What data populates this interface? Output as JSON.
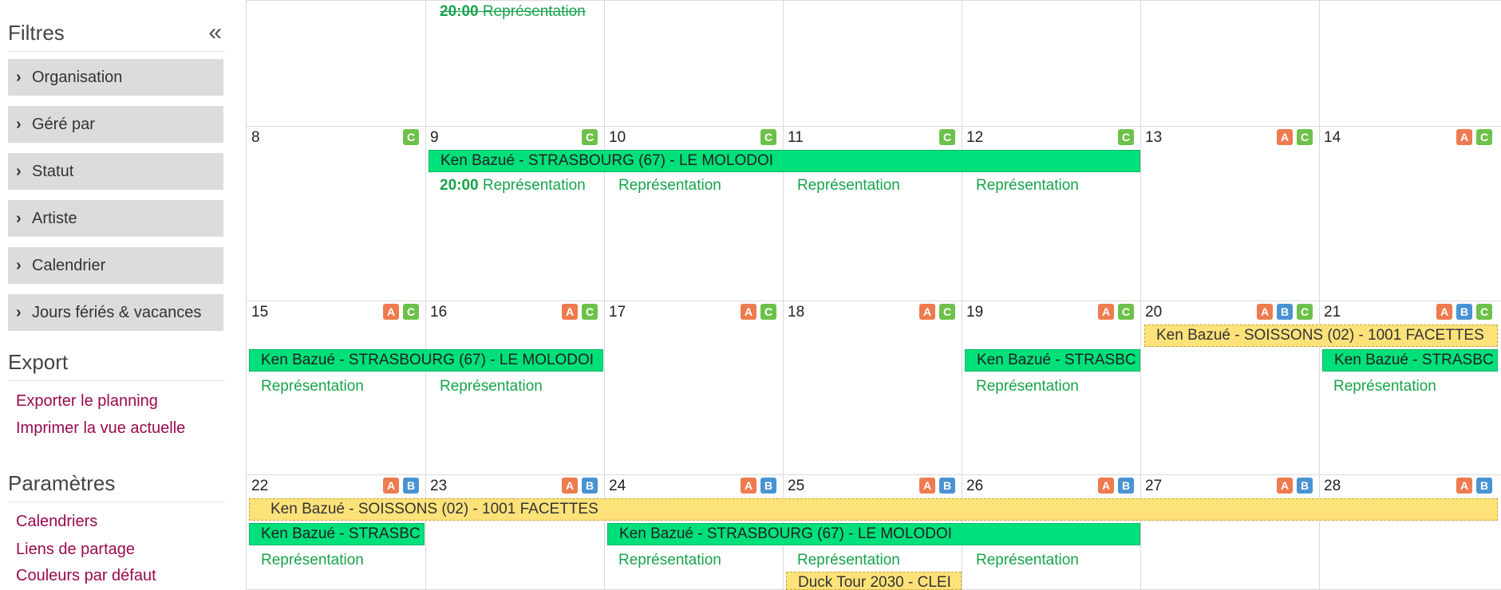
{
  "sidebar": {
    "filters_title": "Filtres",
    "collapse_icon": "«",
    "filters": [
      {
        "label": "Organisation"
      },
      {
        "label": "Géré par"
      },
      {
        "label": "Statut"
      },
      {
        "label": "Artiste"
      },
      {
        "label": "Calendrier"
      },
      {
        "label": "Jours fériés & vacances"
      }
    ],
    "export_title": "Export",
    "export_links": [
      "Exporter le planning",
      "Imprimer la vue actuelle"
    ],
    "params_title": "Paramètres",
    "params_links": [
      "Calendriers",
      "Liens de partage",
      "Couleurs par défaut"
    ]
  },
  "calendar": {
    "colors": {
      "A": "#ee7b4f",
      "B": "#4a93d3",
      "C": "#6dc14a",
      "event_green": "#00e07a",
      "event_yellow": "#fde27a",
      "rep_text": "#18a34a"
    },
    "week1": {
      "event": {
        "time": "20:00",
        "label": "Représentation"
      }
    },
    "week2": {
      "days": [
        {
          "num": "8",
          "badges": [
            "C"
          ]
        },
        {
          "num": "9",
          "badges": [
            "C"
          ]
        },
        {
          "num": "10",
          "badges": [
            "C"
          ]
        },
        {
          "num": "11",
          "badges": [
            "C"
          ]
        },
        {
          "num": "12",
          "badges": [
            "C"
          ]
        },
        {
          "num": "13",
          "badges": [
            "A",
            "C"
          ]
        },
        {
          "num": "14",
          "badges": [
            "A",
            "C"
          ]
        }
      ],
      "green_event": "Ken Bazué - STRASBOURG (67) - LE MOLODOI",
      "first_rep_time": "20:00",
      "rep_label": "Représentation"
    },
    "week3": {
      "days": [
        {
          "num": "15",
          "badges": [
            "A",
            "C"
          ]
        },
        {
          "num": "16",
          "badges": [
            "A",
            "C"
          ]
        },
        {
          "num": "17",
          "badges": [
            "A",
            "C"
          ]
        },
        {
          "num": "18",
          "badges": [
            "A",
            "C"
          ]
        },
        {
          "num": "19",
          "badges": [
            "A",
            "C"
          ]
        },
        {
          "num": "20",
          "badges": [
            "A",
            "B",
            "C"
          ]
        },
        {
          "num": "21",
          "badges": [
            "A",
            "B",
            "C"
          ]
        }
      ],
      "green_event_full": "Ken Bazué - STRASBOURG (67) - LE MOLODOI",
      "green_event_short": "Ken Bazué - STRASBC",
      "yellow_event": "Ken Bazué - SOISSONS (02) - 1001 FACETTES",
      "rep_label": "Représentation"
    },
    "week4": {
      "days": [
        {
          "num": "22",
          "badges": [
            "A",
            "B"
          ]
        },
        {
          "num": "23",
          "badges": [
            "A",
            "B"
          ]
        },
        {
          "num": "24",
          "badges": [
            "A",
            "B"
          ]
        },
        {
          "num": "25",
          "badges": [
            "A",
            "B"
          ]
        },
        {
          "num": "26",
          "badges": [
            "A",
            "B"
          ]
        },
        {
          "num": "27",
          "badges": [
            "A",
            "B"
          ]
        },
        {
          "num": "28",
          "badges": [
            "A",
            "B"
          ]
        }
      ],
      "yellow_event": "Ken Bazué - SOISSONS (02) - 1001 FACETTES",
      "green_event_short": "Ken Bazué - STRASBC",
      "green_event_full": "Ken Bazué - STRASBOURG (67) - LE MOLODOI",
      "rep_label": "Représentation",
      "duck_event": "Duck Tour 2030 - CLEI"
    }
  }
}
